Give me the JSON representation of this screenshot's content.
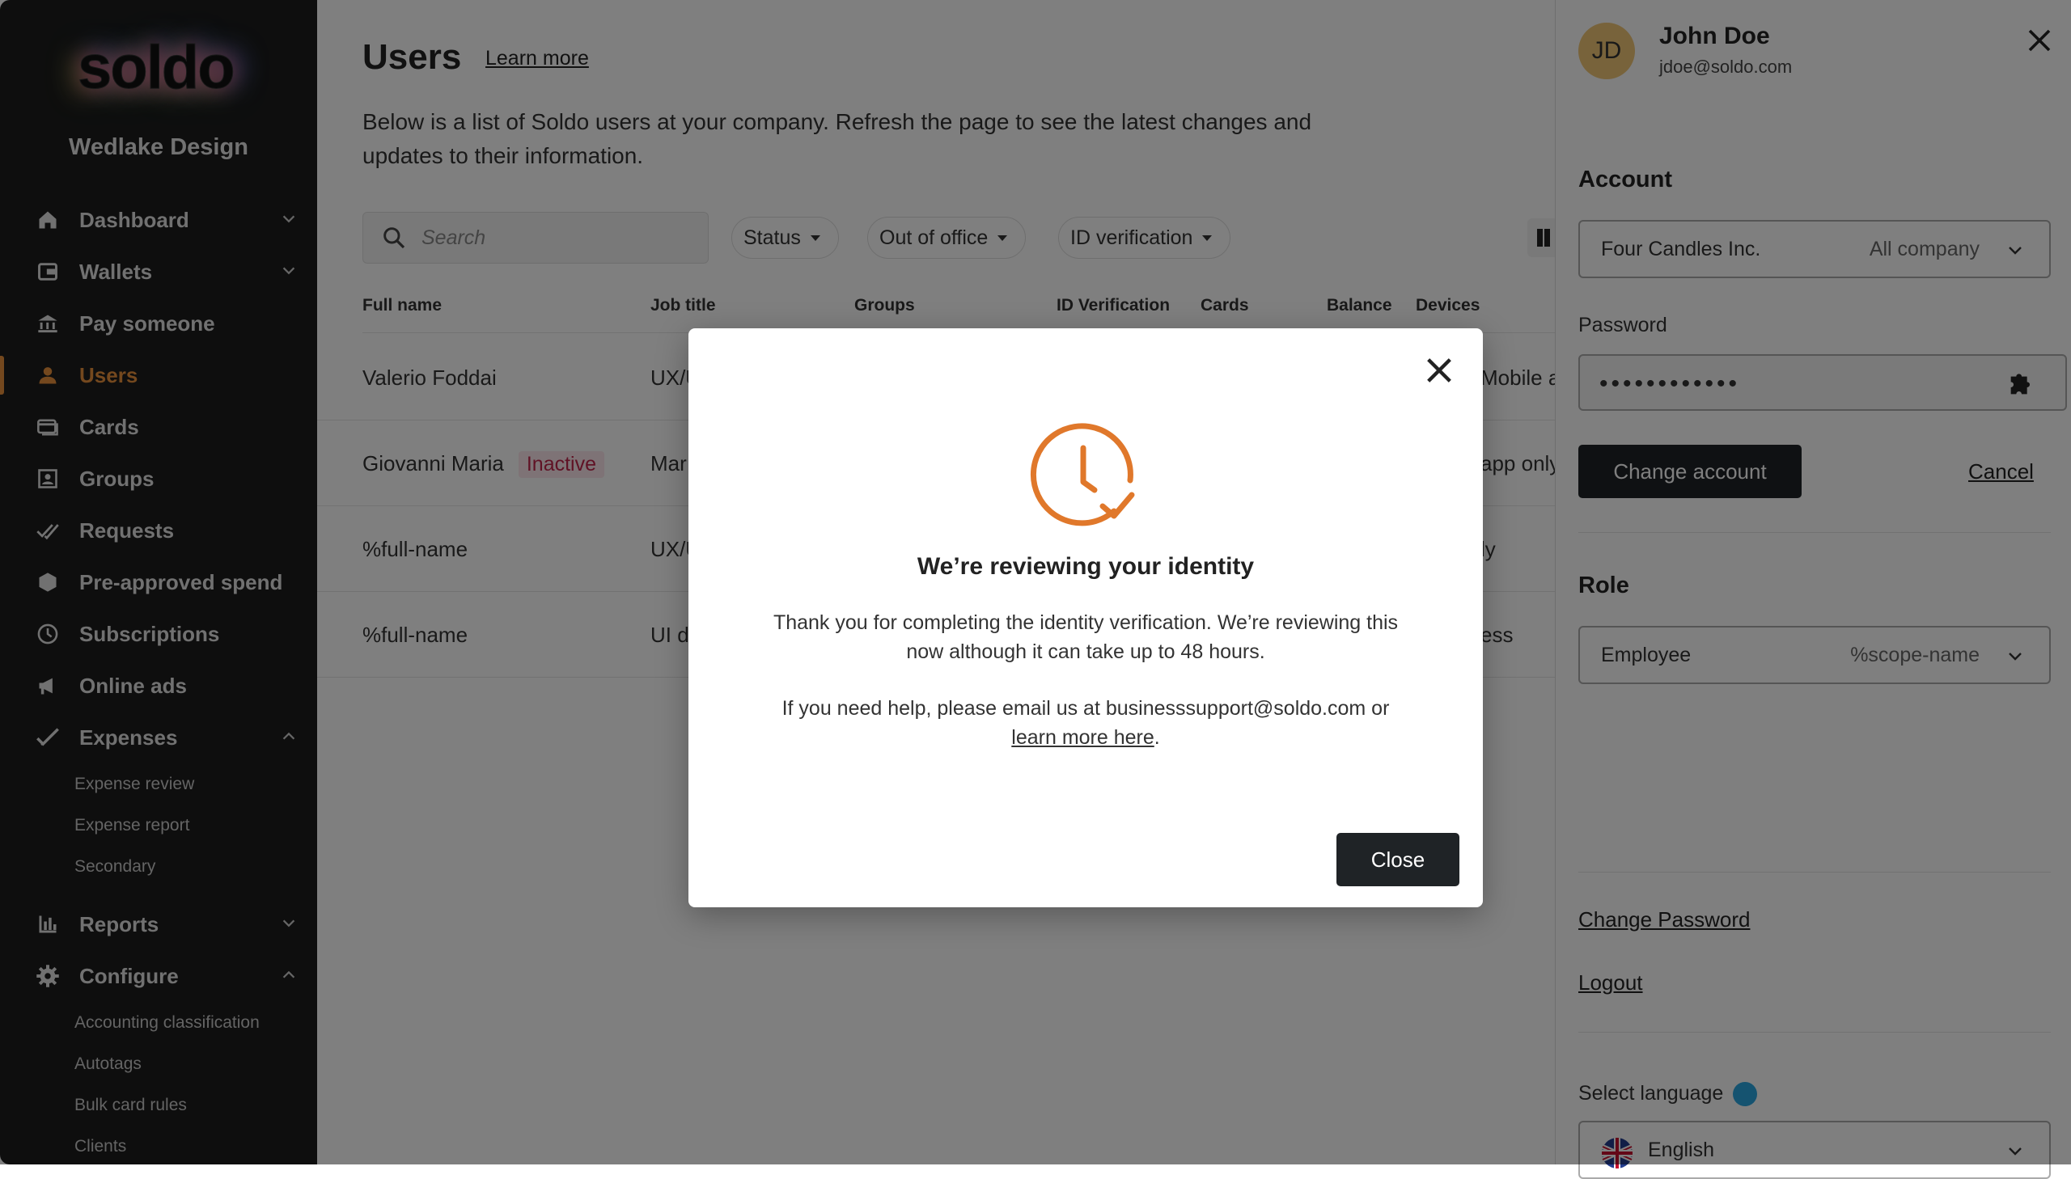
{
  "brand": {
    "logo": "soldo",
    "company": "Wedlake Design"
  },
  "sidebar": {
    "items": [
      {
        "label": "Dashboard"
      },
      {
        "label": "Wallets"
      },
      {
        "label": "Pay someone"
      },
      {
        "label": "Users"
      },
      {
        "label": "Cards"
      },
      {
        "label": "Groups"
      },
      {
        "label": "Requests"
      },
      {
        "label": "Pre-approved spend"
      },
      {
        "label": "Subscriptions"
      },
      {
        "label": "Online ads"
      },
      {
        "label": "Expenses"
      },
      {
        "label": "Reports"
      },
      {
        "label": "Configure"
      }
    ],
    "expenses_sub": [
      "Expense review",
      "Expense report",
      "Secondary"
    ],
    "configure_sub": [
      "Accounting classification",
      "Autotags",
      "Bulk card rules",
      "Clients"
    ]
  },
  "main": {
    "title": "Users",
    "learn_more": "Learn more",
    "description": "Below is a list of Soldo users at your company. Refresh the page to see the latest changes and updates to their information.",
    "search_placeholder": "Search",
    "filters": [
      "Status",
      "Out of office",
      "ID verification"
    ],
    "columns": [
      "Full name",
      "Job title",
      "Groups",
      "ID Verification",
      "Cards",
      "Balance",
      "Devices"
    ],
    "rows": [
      {
        "name": "Valerio Foddai",
        "badge": "",
        "job": "UX/U",
        "devices": "Mobile a"
      },
      {
        "name": "Giovanni Maria",
        "badge": "Inactive",
        "job": "Mar",
        "devices": "app only"
      },
      {
        "name": "%full-name",
        "badge": "",
        "job": "UX/U",
        "devices": "ly"
      },
      {
        "name": "%full-name",
        "badge": "",
        "job": "UI d",
        "devices": "ess"
      }
    ]
  },
  "panel": {
    "initials": "JD",
    "name": "John Doe",
    "email": "jdoe@soldo.com",
    "account_title": "Account",
    "account_value": "Four Candles Inc.",
    "account_scope": "All company",
    "password_label": "Password",
    "password_value": "••••••••••••",
    "change_account": "Change account",
    "cancel": "Cancel",
    "role_title": "Role",
    "role_value": "Employee",
    "role_scope": "%scope-name",
    "change_password": "Change Password",
    "logout": "Logout",
    "language_label": "Select language",
    "language_value": "English"
  },
  "modal": {
    "title": "We’re reviewing your identity",
    "text1": "Thank you for completing the identity verification. We’re reviewing this now although it can take up to 48 hours.",
    "text2_pre": "If you need help, please email us at businesssupport@soldo.com or",
    "text2_link": "learn more here",
    "text2_post": ".",
    "close": "Close"
  },
  "colors": {
    "accent": "#e8903d",
    "sidebar": "#1c1c1c",
    "dark_button": "#1f2326",
    "badge_text": "#c0254b"
  },
  "icons": [
    "home-icon",
    "wallet-icon",
    "bank-icon",
    "user-icon",
    "cards-icon",
    "groups-icon",
    "requests-icon",
    "shield-icon",
    "clock-icon",
    "megaphone-icon",
    "checkmark-icon",
    "chart-icon",
    "gear-icon",
    "search-icon",
    "close-icon",
    "puzzle-icon",
    "flag-uk-icon"
  ]
}
